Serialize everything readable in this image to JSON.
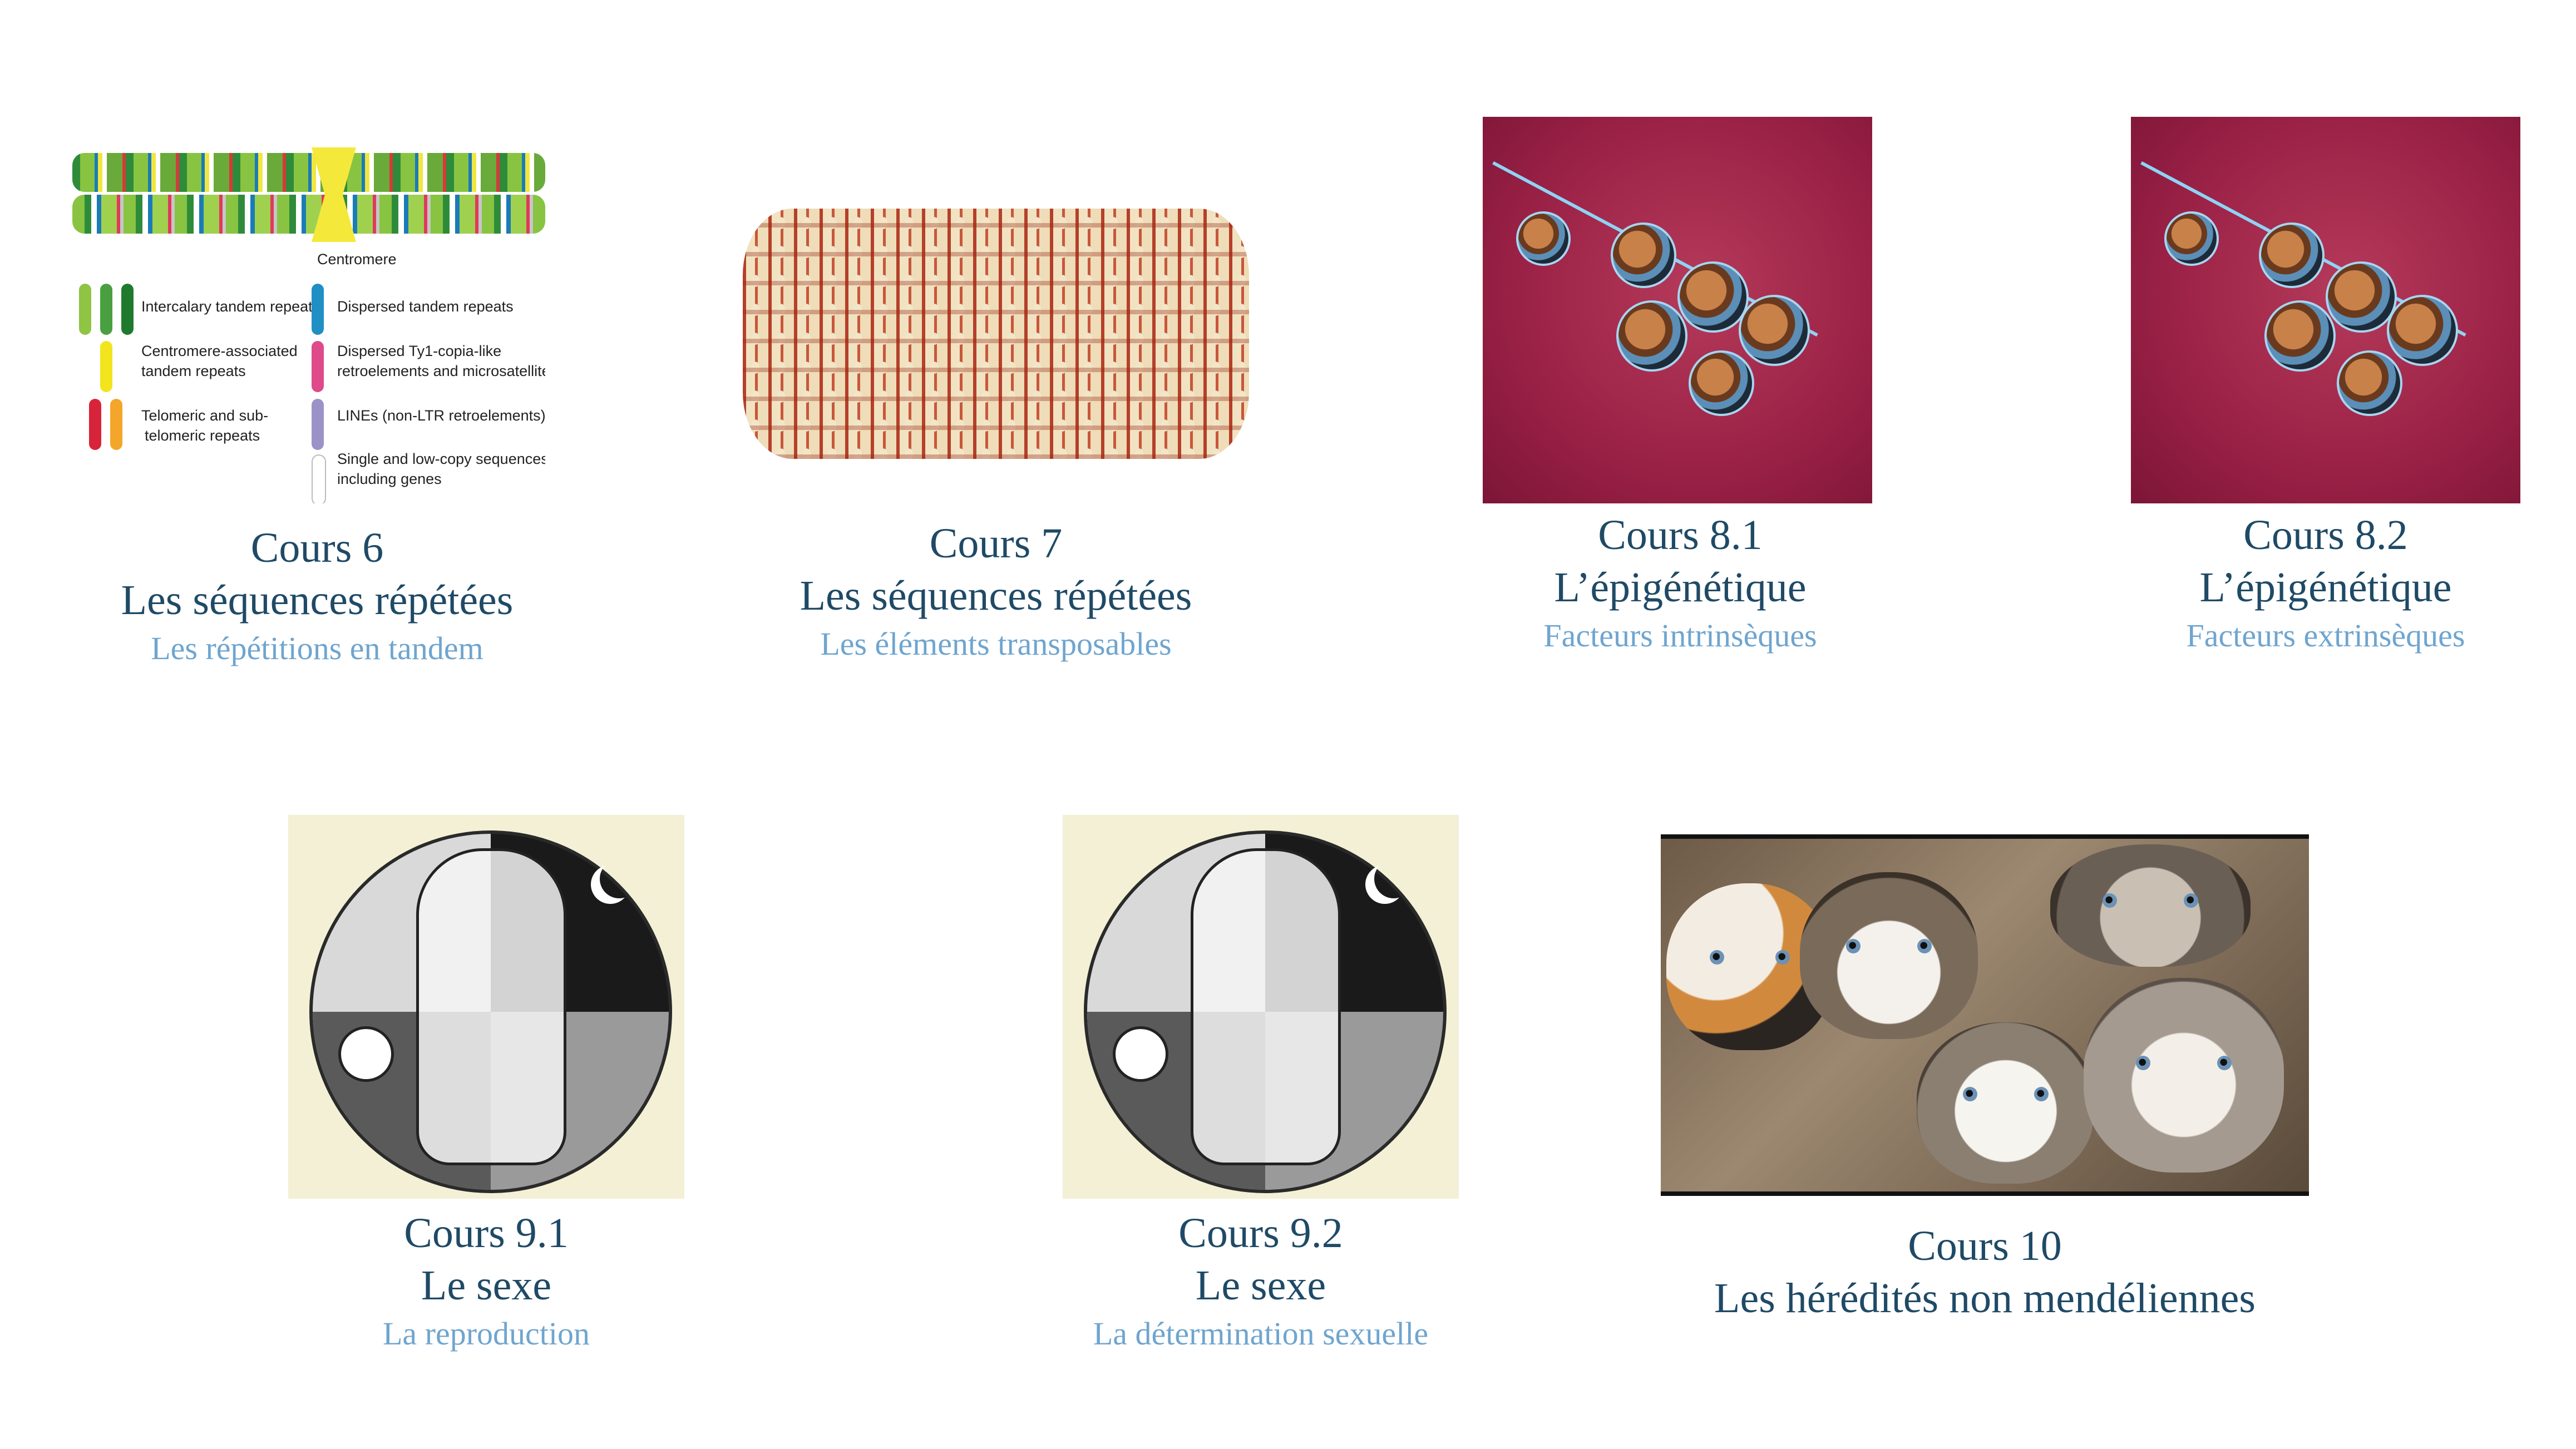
{
  "cards": [
    {
      "id": "cours6",
      "line1": "Cours 6",
      "line2": "Les séquences répétées",
      "line3": "Les répétitions en tandem",
      "image": {
        "centromere_label": "Centromere",
        "legend": [
          "Intercalary tandem repeats",
          "Dispersed tandem repeats",
          "Centromere-associated",
          "tandem repeats",
          "Dispersed Ty1-copia-like",
          "retroelements and microsatellites",
          "Telomeric and sub-",
          "telomeric repeats",
          "LINEs (non-LTR retroelements)",
          "Single and low-copy sequences",
          "including genes"
        ]
      }
    },
    {
      "id": "cours7",
      "line1": "Cours 7",
      "line2": "Les séquences répétées",
      "line3": "Les éléments transposables"
    },
    {
      "id": "cours81",
      "line1": "Cours 8.1",
      "line2": "L’épigénétique",
      "line3": "Facteurs intrinsèques"
    },
    {
      "id": "cours82",
      "line1": "Cours 8.2",
      "line2": "L’épigénétique",
      "line3": "Facteurs extrinsèques"
    },
    {
      "id": "cours91",
      "line1": "Cours 9.1",
      "line2": "Le sexe",
      "line3": "La reproduction"
    },
    {
      "id": "cours92",
      "line1": "Cours 9.2",
      "line2": "Le sexe",
      "line3": "La détermination sexuelle"
    },
    {
      "id": "cours10",
      "line1": "Cours 10",
      "line2": "Les hérédités non mendéliennes"
    }
  ],
  "colors": {
    "title": "#1f4a66",
    "subtitle": "#6fa5cf",
    "epi_bg": "#9a2146",
    "sexe_bg": "#f3f0d6"
  },
  "icons": {
    "cours6": "chromosome-diagram-icon",
    "cours7": "corn-cob-icon",
    "cours8": "chromatin-nucleosome-icon",
    "cours9": "sexual-symbol-drawing-icon",
    "cours10": "kittens-photo-icon"
  }
}
